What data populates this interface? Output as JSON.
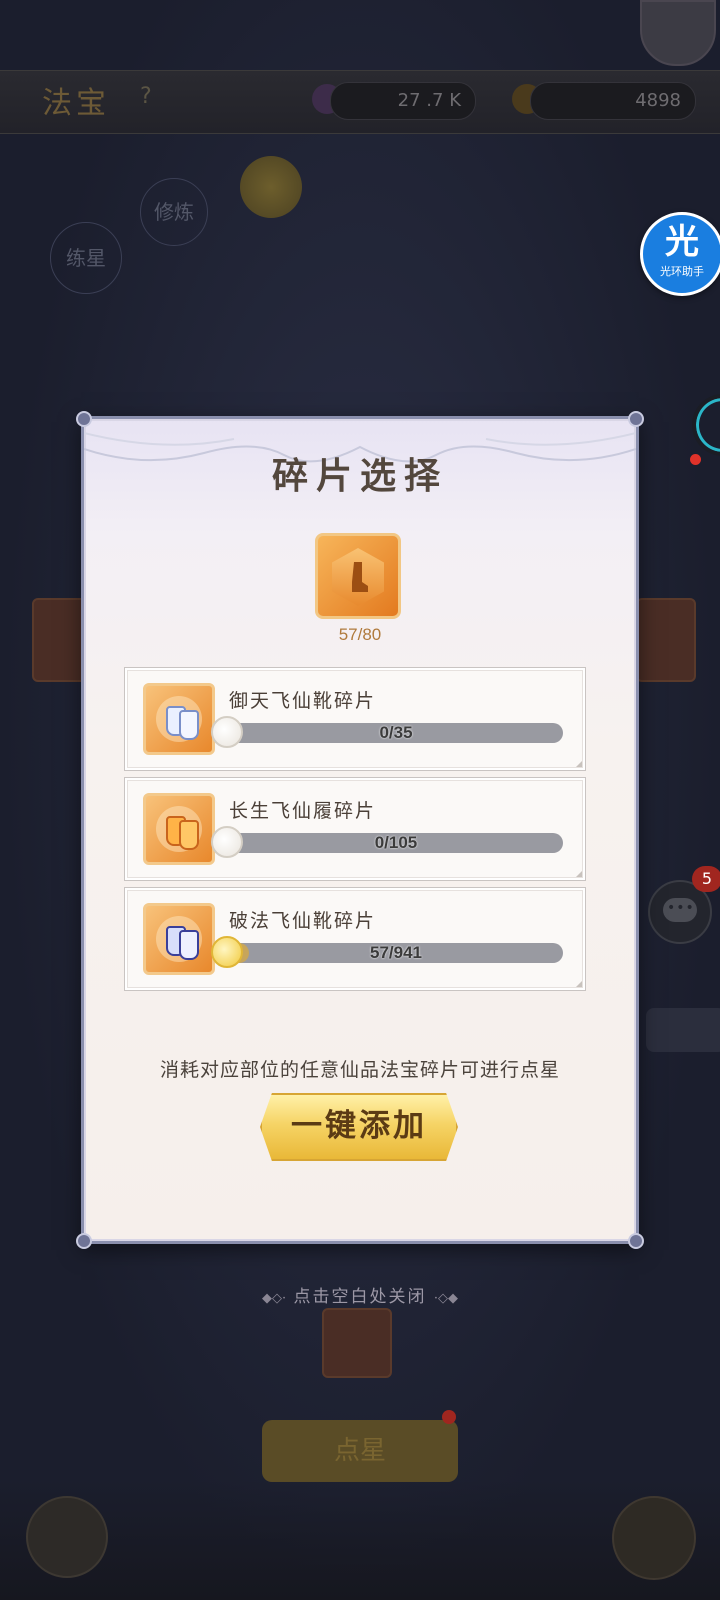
{
  "background": {
    "page_title": "法宝",
    "help_symbol": "?",
    "resource_1": "27 .7 K",
    "resource_2": "4898",
    "node_1": "修炼",
    "node_2": "练星",
    "bottom_button": "点星"
  },
  "overlay": {
    "halo_glyph": "光",
    "halo_label": "光环助手",
    "chat_badge": "5"
  },
  "dialog": {
    "title": "碎片选择",
    "target": {
      "icon": "boot-icon",
      "count": "57/80"
    },
    "fragments": [
      {
        "name": "御天飞仙靴碎片",
        "value": "0/35",
        "progress": 0.0,
        "knob": "empty"
      },
      {
        "name": "长生飞仙履碎片",
        "value": "0/105",
        "progress": 0.0,
        "knob": "empty"
      },
      {
        "name": "破法飞仙靴碎片",
        "value": "57/941",
        "progress": 0.06,
        "knob": "gold"
      }
    ],
    "hint": "消耗对应部位的任意仙品法宝碎片可进行点星",
    "add_button": "一键添加"
  },
  "close_hint": "点击空白处关闭",
  "colors": {
    "dialog_border": "#8a8fad",
    "button_gold": "#f6d466",
    "title_text": "#53473d",
    "bar_track": "#999aa1"
  }
}
